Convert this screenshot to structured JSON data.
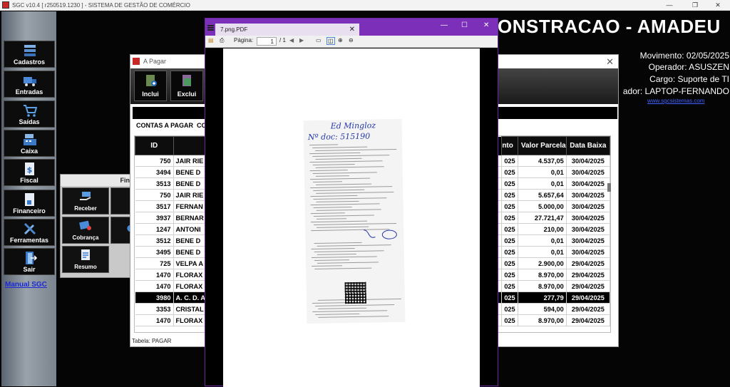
{
  "window": {
    "title": "SGC v10.4 [ r250519.1230 ] - SISTEMA DE GESTÃO DE COMÉRCIO"
  },
  "sidebar": {
    "items": [
      {
        "label": "Cadastros",
        "icon": "stack-icon"
      },
      {
        "label": "Entradas",
        "icon": "truck-icon"
      },
      {
        "label": "Saídas",
        "icon": "cart-icon"
      },
      {
        "label": "Caixa",
        "icon": "cash-register-icon"
      },
      {
        "label": "Fiscal",
        "icon": "document-dollar-icon"
      },
      {
        "label": "Financeiro",
        "icon": "finance-document-icon"
      },
      {
        "label": "Ferramentas",
        "icon": "tools-icon"
      },
      {
        "label": "Sair",
        "icon": "exit-door-icon"
      }
    ],
    "manual": "Manual SGC"
  },
  "header": {
    "company": "ONSTRACAO - AMADEU",
    "movimento": "Movimento: 02/05/2025",
    "operador": "Operador: ASUSZEN",
    "cargo": "Cargo: Suporte de TI",
    "computador": "ador: LAPTOP-FERNANDO",
    "site": "www.sgcsistemas.com"
  },
  "financeiro_panel": {
    "title": "Fina",
    "buttons": [
      "Receber",
      "P",
      "Cobrança",
      "",
      "Resumo"
    ]
  },
  "apagar": {
    "title": "A Pagar",
    "toolbar": {
      "incluir": "Inclui",
      "excluir": "Exclui"
    },
    "list_label": "CONTAS A PAGAR",
    "list_label_extra": "CO",
    "columns": {
      "id": "ID",
      "dt": "nto",
      "valor": "Valor Parcela",
      "baixa": "Data Baixa"
    },
    "rows": [
      {
        "id": "750",
        "name": "JAIR RIE",
        "dt": "025",
        "valor": "4.537,05",
        "baixa": "30/04/2025"
      },
      {
        "id": "3494",
        "name": "BENE D",
        "dt": "025",
        "valor": "0,01",
        "baixa": "30/04/2025"
      },
      {
        "id": "3513",
        "name": "BENE D",
        "dt": "025",
        "valor": "0,01",
        "baixa": "30/04/2025"
      },
      {
        "id": "750",
        "name": "JAIR RIE",
        "dt": "025",
        "valor": "5.657,64",
        "baixa": "30/04/2025"
      },
      {
        "id": "3517",
        "name": "FERNAN",
        "dt": "025",
        "valor": "5.000,00",
        "baixa": "30/04/2025"
      },
      {
        "id": "3937",
        "name": "BERNAR",
        "dt": "025",
        "valor": "27.721,47",
        "baixa": "30/04/2025"
      },
      {
        "id": "1247",
        "name": "ANTONI",
        "dt": "025",
        "valor": "210,00",
        "baixa": "30/04/2025"
      },
      {
        "id": "3512",
        "name": "BENE D",
        "dt": "025",
        "valor": "0,01",
        "baixa": "30/04/2025"
      },
      {
        "id": "3495",
        "name": "BENE D",
        "dt": "025",
        "valor": "0,01",
        "baixa": "30/04/2025"
      },
      {
        "id": "725",
        "name": "VELPA A",
        "dt": "025",
        "valor": "2.900,00",
        "baixa": "29/04/2025"
      },
      {
        "id": "1470",
        "name": "FLORAX",
        "dt": "025",
        "valor": "8.970,00",
        "baixa": "29/04/2025"
      },
      {
        "id": "1470",
        "name": "FLORAX",
        "dt": "025",
        "valor": "8.970,00",
        "baixa": "29/04/2025"
      },
      {
        "id": "3980",
        "name": "A. C. D. A",
        "dt": "025",
        "valor": "277,79",
        "baixa": "29/04/2025"
      },
      {
        "id": "3353",
        "name": "CRISTAL",
        "dt": "025",
        "valor": "594,00",
        "baixa": "29/04/2025"
      },
      {
        "id": "1470",
        "name": "FLORAX",
        "dt": "025",
        "valor": "8.970,00",
        "baixa": "29/04/2025"
      }
    ],
    "status": "Tabela: PAGAR"
  },
  "pdf": {
    "tab": "7.png.PDF",
    "page_label": "Página:",
    "page": "1",
    "of": "/ 1",
    "handwriting": {
      "name": "Ed Mingloz",
      "doc": "Nº doc: 515190"
    },
    "accent": "#7c2fb8"
  }
}
